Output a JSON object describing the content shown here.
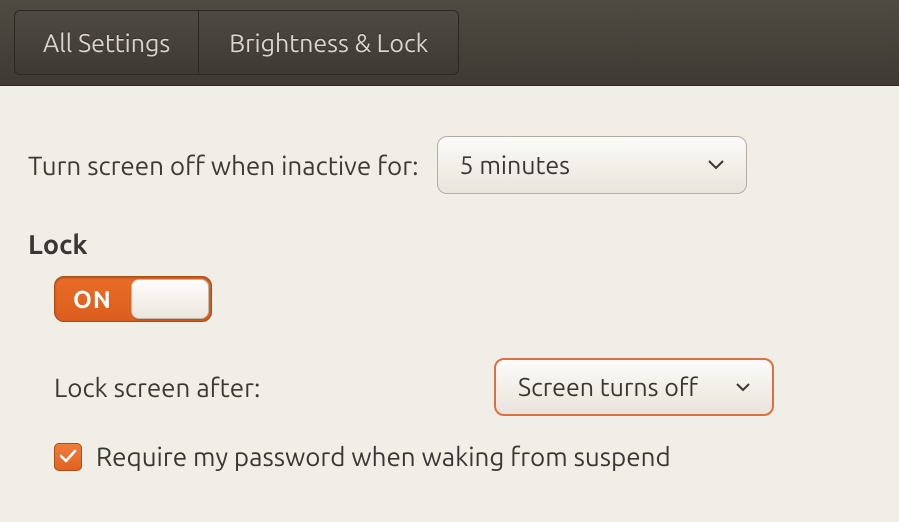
{
  "toolbar": {
    "all_settings": "All Settings",
    "page_title": "Brightness & Lock"
  },
  "inactive": {
    "label": "Turn screen off when inactive for:",
    "value": "5 minutes"
  },
  "lock": {
    "heading": "Lock",
    "toggle_on_label": "ON",
    "toggle_state": "on"
  },
  "lock_after": {
    "label": "Lock screen after:",
    "value": "Screen turns off"
  },
  "require_password": {
    "checked": true,
    "label": "Require my password when waking from suspend"
  }
}
